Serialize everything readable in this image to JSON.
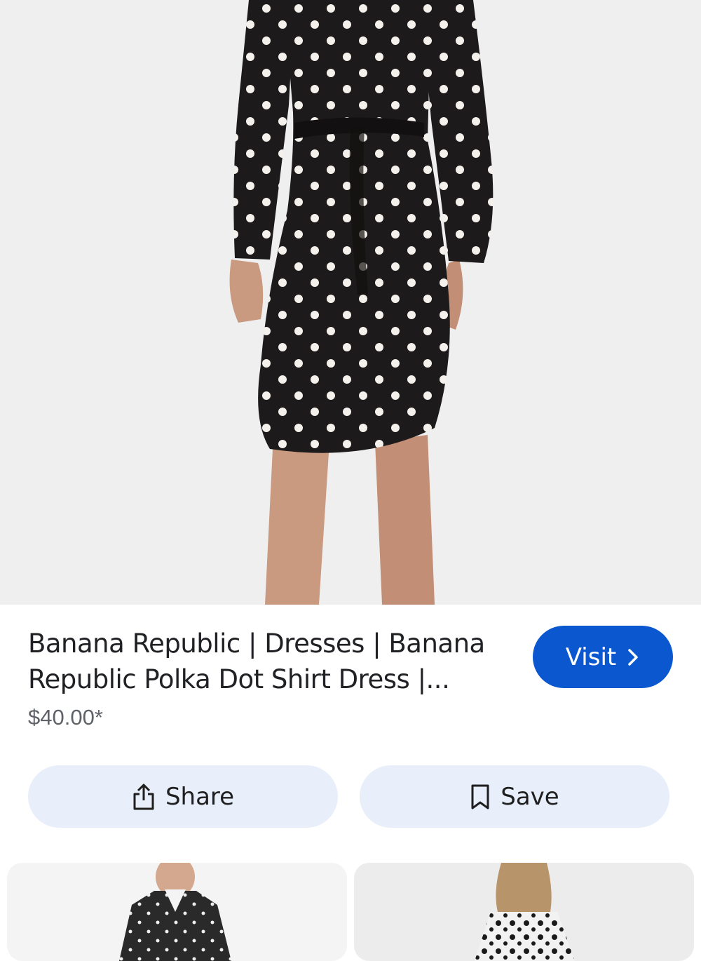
{
  "product": {
    "title": "Banana Republic | Dresses | Banana Republic Polka Dot Shirt Dress |...",
    "price": "$40.00*"
  },
  "actions": {
    "visit_label": "Visit",
    "share_label": "Share",
    "save_label": "Save"
  },
  "colors": {
    "visit_button": "#0b57d0",
    "action_button": "#e8eefa",
    "hero_background": "#f0f0f0"
  },
  "icons": {
    "visit": "chevron-right-icon",
    "share": "share-icon",
    "save": "bookmark-icon"
  }
}
